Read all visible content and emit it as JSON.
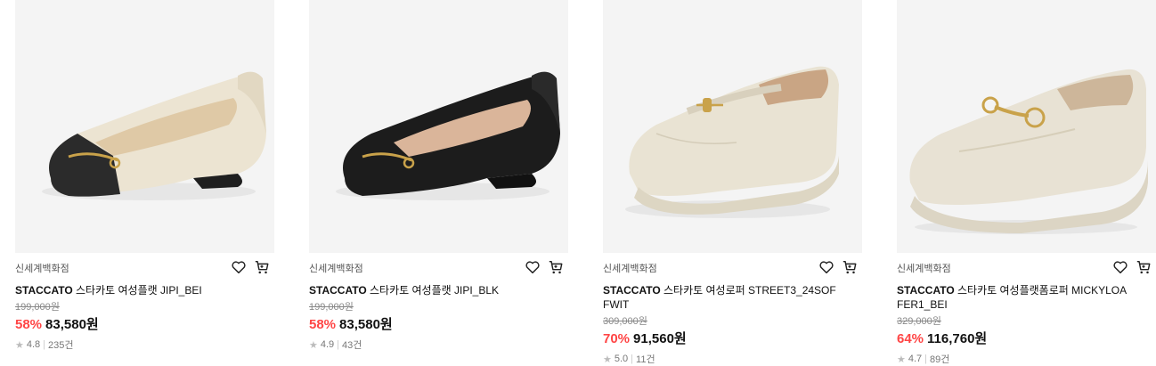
{
  "products": [
    {
      "store": "신세계백화점",
      "brand": "STACCATO",
      "name": "스타카토 여성플랫 JIPI_BEI",
      "original_price": "199,000원",
      "discount": "58%",
      "price": "83,580원",
      "rating": "4.8",
      "reviews": "235건",
      "image_icon": "ballet-flat-beige-black-toe"
    },
    {
      "store": "신세계백화점",
      "brand": "STACCATO",
      "name": "스타카토 여성플랫 JIPI_BLK",
      "original_price": "199,000원",
      "discount": "58%",
      "price": "83,580원",
      "rating": "4.9",
      "reviews": "43건",
      "image_icon": "ballet-flat-black"
    },
    {
      "store": "신세계백화점",
      "brand": "STACCATO",
      "name": "스타카토 여성로퍼 STREET3_24SOF FWIT",
      "original_price": "309,000원",
      "discount": "70%",
      "price": "91,560원",
      "rating": "5.0",
      "reviews": "11건",
      "image_icon": "loafer-ivory-chunky"
    },
    {
      "store": "신세계백화점",
      "brand": "STACCATO",
      "name": "스타카토 여성플랫폼로퍼 MICKYLOA FER1_BEI",
      "original_price": "329,000원",
      "discount": "64%",
      "price": "116,760원",
      "rating": "4.7",
      "reviews": "89건",
      "image_icon": "platform-loafer-beige"
    }
  ],
  "colors": {
    "discount": "#ff4545",
    "star": "#bcbcbc",
    "thumb_bg": "#f4f4f4"
  }
}
